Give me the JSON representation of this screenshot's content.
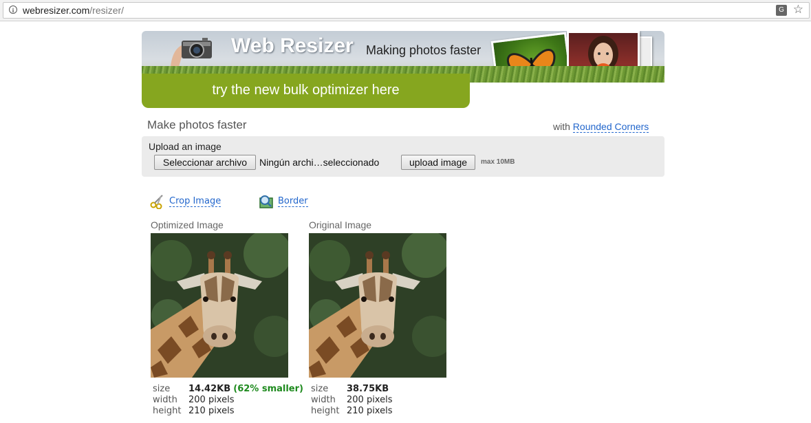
{
  "browser": {
    "url_host": "webresizer.com",
    "url_path": "/resizer/"
  },
  "banner": {
    "title": "Web Resizer",
    "tagline": "Making photos faster",
    "bulk_link": "try the new bulk optimizer here"
  },
  "headline": "Make photos faster",
  "rounded": {
    "prefix": "with",
    "link": "Rounded Corners"
  },
  "upload": {
    "label": "Upload an image",
    "choose_button": "Seleccionar archivo",
    "file_status": "Ningún archi…seleccionado",
    "upload_button": "upload image",
    "max_size": "max 10MB"
  },
  "tools": {
    "crop": "Crop Image",
    "border": "Border"
  },
  "optimized": {
    "title": "Optimized Image",
    "size_label": "size",
    "size_value": "14.42KB",
    "size_note": "(62% smaller)",
    "width_label": "width",
    "width_value": "200 pixels",
    "height_label": "height",
    "height_value": "210 pixels"
  },
  "original": {
    "title": "Original Image",
    "size_label": "size",
    "size_value": "38.75KB",
    "width_label": "width",
    "width_value": "200 pixels",
    "height_label": "height",
    "height_value": "210 pixels"
  },
  "colors": {
    "accent_green": "#86a61f",
    "link_blue": "#2266cc",
    "smaller_green": "#1e8a1e"
  }
}
